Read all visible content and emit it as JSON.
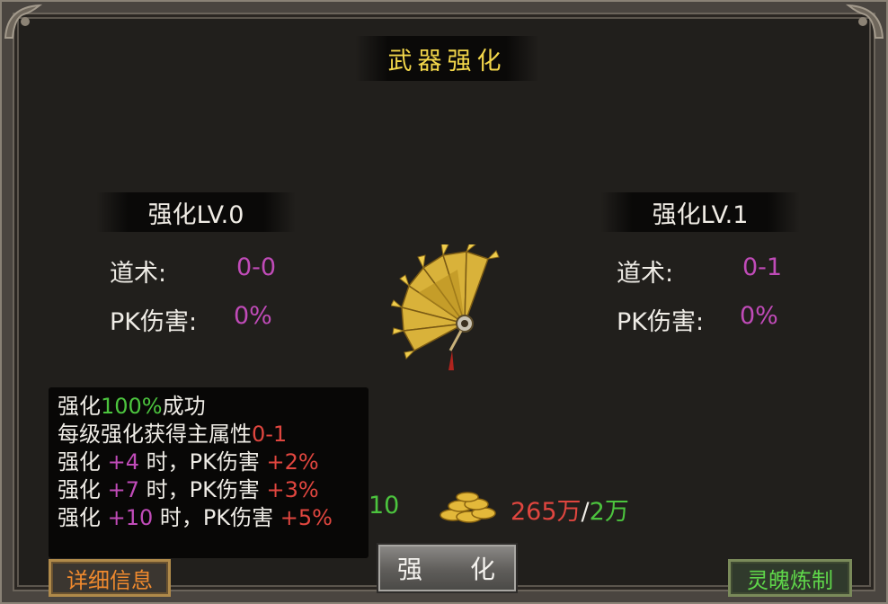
{
  "window": {
    "title": "武器强化"
  },
  "current": {
    "level_label": "强化LV.0",
    "stats": [
      {
        "name": "道术:",
        "value": "0-0"
      },
      {
        "name": "PK伤害:",
        "value": "0%"
      }
    ]
  },
  "next": {
    "level_label": "强化LV.1",
    "stats": [
      {
        "name": "道术:",
        "value": "0-1"
      },
      {
        "name": "PK伤害:",
        "value": "0%"
      }
    ]
  },
  "weapon": {
    "icon": "golden-fan-weapon-icon"
  },
  "tooltip": {
    "line1": {
      "a": "强化",
      "b": "100%",
      "c": "成功"
    },
    "line2": {
      "a": "每级强化获得主属性",
      "b": "0-1"
    },
    "line3": {
      "a": "强化 ",
      "b": "+4",
      "c": " 时，PK伤害 ",
      "d": "+2%"
    },
    "line4": {
      "a": "强化 ",
      "b": "+7",
      "c": " 时，PK伤害 ",
      "d": "+3%"
    },
    "line5": {
      "a": "强化 ",
      "b": "+10",
      "c": " 时，PK伤害 ",
      "d": "+5%"
    }
  },
  "cost": {
    "item_count": "10",
    "gold_icon": "gold-coins-icon",
    "gold_have": "265万",
    "separator": "/",
    "gold_need": "2万"
  },
  "buttons": {
    "enhance": "强 化",
    "detail": "详细信息",
    "soul_refine": "灵魄炼制"
  },
  "colors": {
    "title": "#f2d64a",
    "value_magenta": "#c04bb8",
    "success_green": "#4cc43e",
    "bonus_red": "#e0463f",
    "detail_orange": "#f08a2e",
    "soul_green": "#5fd64a"
  }
}
